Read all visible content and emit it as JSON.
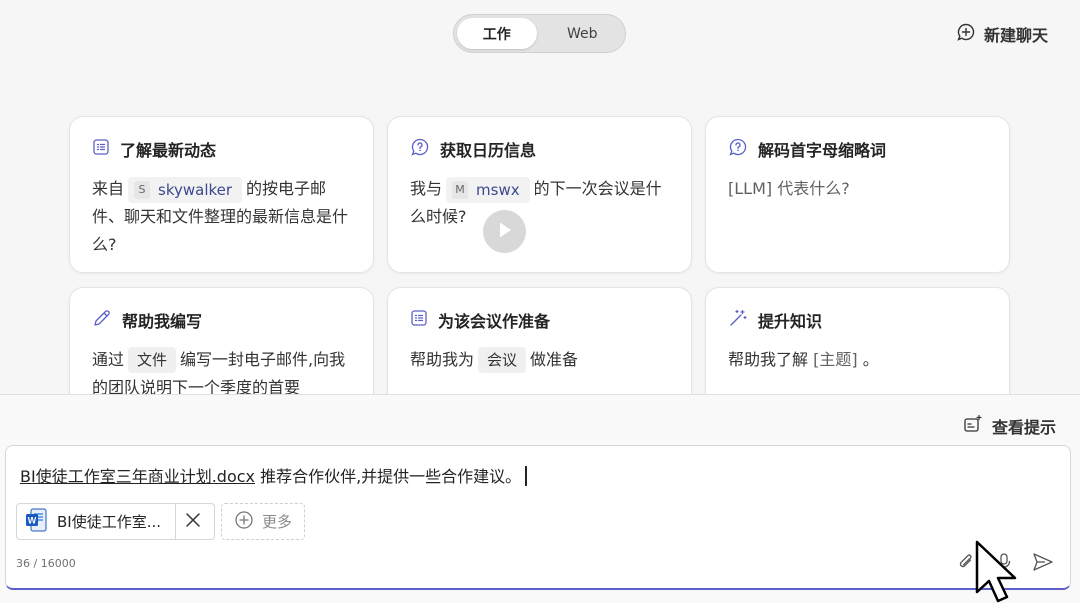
{
  "mode_toggle": {
    "work_label": "工作",
    "web_label": "Web",
    "selected": "工作"
  },
  "header": {
    "new_chat_label": "新建聊天"
  },
  "cards": [
    {
      "icon": "list-icon",
      "title": "了解最新动态",
      "pre": "来自",
      "chip_initial": "S",
      "chip_name": "skywalker",
      "post": "的按电子邮件、聊天和文件整理的最新信息是什么?"
    },
    {
      "icon": "question-chat-icon",
      "title": "获取日历信息",
      "pre": "我与",
      "chip_initial": "M",
      "chip_name": "mswx",
      "post": "的下一次会议是什么时候?"
    },
    {
      "icon": "question-chat-icon",
      "title": "解码首字母缩略词",
      "body": "[LLM] 代表什么?"
    },
    {
      "icon": "pen-icon",
      "title": "帮助我编写",
      "pre": "通过",
      "chip_text": "文件",
      "post": "编写一封电子邮件,向我的团队说明下一个季度的首要"
    },
    {
      "icon": "list-icon",
      "title": "为该会议作准备",
      "pre": "帮助我为",
      "chip_text": "会议",
      "post": "做准备"
    },
    {
      "icon": "magic-wand-icon",
      "title": "提升知识",
      "pre": "帮助我了解",
      "placeholder": "[主题]",
      "post": "。"
    }
  ],
  "bottom": {
    "view_prompts_label": "查看提示",
    "composer": {
      "doc_link": "BI使徒工作室三年商业计划.docx",
      "message": " 推荐合作伙伴,并提供一些合作建议。",
      "attachment_name": "BI使徒工作室...",
      "more_label": "更多",
      "char_count": "36 / 16000"
    }
  },
  "colors": {
    "accent": "#5b5fc7",
    "chip_user": "#3b4a8c",
    "word_blue": "#185abd"
  }
}
